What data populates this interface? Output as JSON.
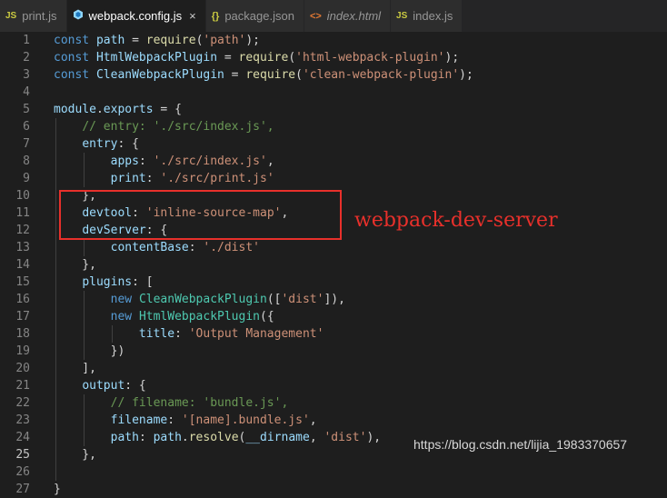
{
  "tabs": [
    {
      "icon": "JS",
      "label": "print.js",
      "active": false
    },
    {
      "icon": "JS",
      "label": "webpack.config.js",
      "active": true
    },
    {
      "icon": "{}",
      "label": "package.json",
      "active": false
    },
    {
      "icon": "<>",
      "label": "index.html",
      "active": false
    },
    {
      "icon": "JS",
      "label": "index.js",
      "active": false
    }
  ],
  "close_glyph": "×",
  "line_numbers": [
    "1",
    "2",
    "3",
    "4",
    "5",
    "6",
    "7",
    "8",
    "9",
    "10",
    "11",
    "12",
    "13",
    "14",
    "15",
    "16",
    "17",
    "18",
    "19",
    "20",
    "21",
    "22",
    "23",
    "24",
    "25",
    "26",
    "27"
  ],
  "current_line": "25",
  "code_lines": [
    [
      [
        "kw",
        "const "
      ],
      [
        "var",
        "path"
      ],
      [
        "p",
        " = "
      ],
      [
        "fn",
        "require"
      ],
      [
        "p",
        "("
      ],
      [
        "str",
        "'path'"
      ],
      [
        "p",
        ");"
      ]
    ],
    [
      [
        "kw",
        "const "
      ],
      [
        "var",
        "HtmlWebpackPlugin"
      ],
      [
        "p",
        " = "
      ],
      [
        "fn",
        "require"
      ],
      [
        "p",
        "("
      ],
      [
        "str",
        "'html-webpack-plugin'"
      ],
      [
        "p",
        ");"
      ]
    ],
    [
      [
        "kw",
        "const "
      ],
      [
        "var",
        "CleanWebpackPlugin"
      ],
      [
        "p",
        " = "
      ],
      [
        "fn",
        "require"
      ],
      [
        "p",
        "("
      ],
      [
        "str",
        "'clean-webpack-plugin'"
      ],
      [
        "p",
        ");"
      ]
    ],
    [],
    [
      [
        "var",
        "module"
      ],
      [
        "p",
        "."
      ],
      [
        "var",
        "exports"
      ],
      [
        "p",
        " = {"
      ]
    ],
    [
      [
        "p",
        "    "
      ],
      [
        "cm",
        "// entry: './src/index.js',"
      ]
    ],
    [
      [
        "p",
        "    "
      ],
      [
        "var",
        "entry"
      ],
      [
        "p",
        ": {"
      ]
    ],
    [
      [
        "p",
        "        "
      ],
      [
        "var",
        "apps"
      ],
      [
        "p",
        ": "
      ],
      [
        "str",
        "'./src/index.js'"
      ],
      [
        "p",
        ","
      ]
    ],
    [
      [
        "p",
        "        "
      ],
      [
        "var",
        "print"
      ],
      [
        "p",
        ": "
      ],
      [
        "str",
        "'./src/print.js'"
      ]
    ],
    [
      [
        "p",
        "    },"
      ]
    ],
    [
      [
        "p",
        "    "
      ],
      [
        "var",
        "devtool"
      ],
      [
        "p",
        ": "
      ],
      [
        "str",
        "'inline-source-map'"
      ],
      [
        "p",
        ","
      ]
    ],
    [
      [
        "p",
        "    "
      ],
      [
        "var",
        "devServer"
      ],
      [
        "p",
        ": {"
      ]
    ],
    [
      [
        "p",
        "        "
      ],
      [
        "var",
        "contentBase"
      ],
      [
        "p",
        ": "
      ],
      [
        "str",
        "'./dist'"
      ]
    ],
    [
      [
        "p",
        "    },"
      ]
    ],
    [
      [
        "p",
        "    "
      ],
      [
        "var",
        "plugins"
      ],
      [
        "p",
        ": ["
      ]
    ],
    [
      [
        "p",
        "        "
      ],
      [
        "kw",
        "new "
      ],
      [
        "cls",
        "CleanWebpackPlugin"
      ],
      [
        "p",
        "(["
      ],
      [
        "str",
        "'dist'"
      ],
      [
        "p",
        "]),"
      ]
    ],
    [
      [
        "p",
        "        "
      ],
      [
        "kw",
        "new "
      ],
      [
        "cls",
        "HtmlWebpackPlugin"
      ],
      [
        "p",
        "({"
      ]
    ],
    [
      [
        "p",
        "            "
      ],
      [
        "var",
        "title"
      ],
      [
        "p",
        ": "
      ],
      [
        "str",
        "'Output Management'"
      ]
    ],
    [
      [
        "p",
        "        })"
      ]
    ],
    [
      [
        "p",
        "    ],"
      ]
    ],
    [
      [
        "p",
        "    "
      ],
      [
        "var",
        "output"
      ],
      [
        "p",
        ": {"
      ]
    ],
    [
      [
        "p",
        "        "
      ],
      [
        "cm",
        "// filename: 'bundle.js',"
      ]
    ],
    [
      [
        "p",
        "        "
      ],
      [
        "var",
        "filename"
      ],
      [
        "p",
        ": "
      ],
      [
        "str",
        "'[name].bundle.js'"
      ],
      [
        "p",
        ","
      ]
    ],
    [
      [
        "p",
        "        "
      ],
      [
        "var",
        "path"
      ],
      [
        "p",
        ": "
      ],
      [
        "var",
        "path"
      ],
      [
        "p",
        "."
      ],
      [
        "fn",
        "resolve"
      ],
      [
        "p",
        "("
      ],
      [
        "var",
        "__dirname"
      ],
      [
        "p",
        ", "
      ],
      [
        "str",
        "'dist'"
      ],
      [
        "p",
        "),"
      ]
    ],
    [
      [
        "p",
        "    },"
      ]
    ],
    [],
    [
      [
        "p",
        "}"
      ]
    ]
  ],
  "annotation": "webpack-dev-server",
  "watermark": "https://blog.csdn.net/lijia_1983370657",
  "colors": {
    "background": "#1e1e1e",
    "keyword": "#569cd6",
    "variable": "#9cdcfe",
    "function": "#dcdcaa",
    "string": "#ce9178",
    "comment": "#6a9955",
    "class": "#4ec9b0",
    "annotation": "#e8302b"
  }
}
